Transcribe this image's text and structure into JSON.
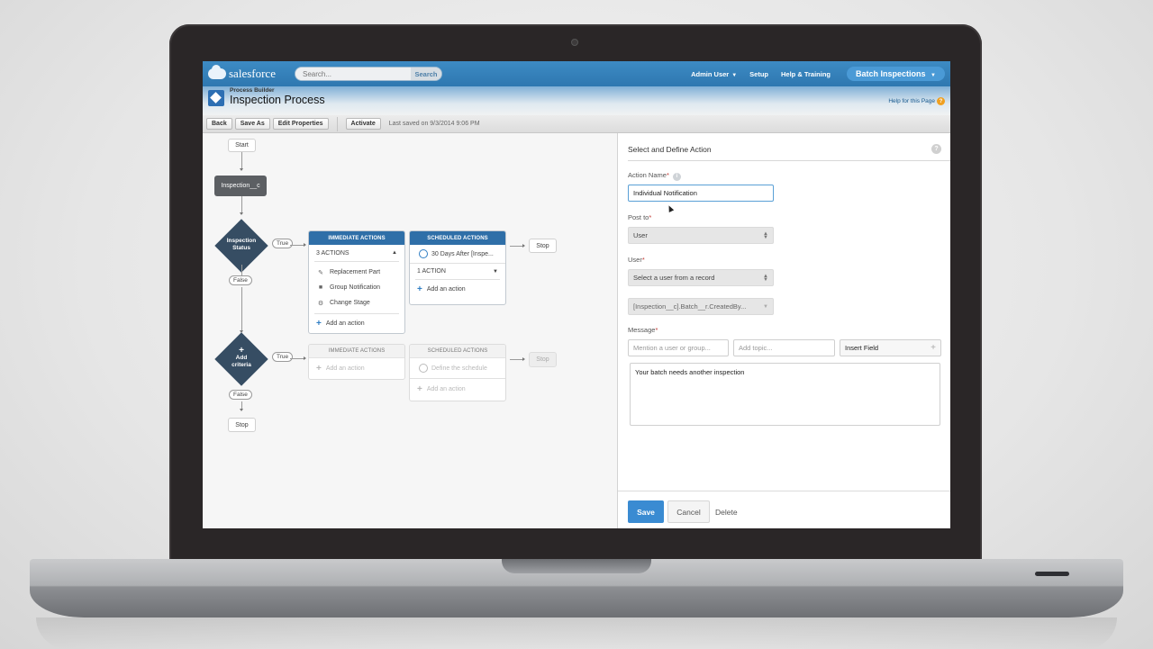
{
  "topbar": {
    "logo_text": "salesforce",
    "search_placeholder": "Search...",
    "search_button": "Search",
    "user_menu": "Admin User",
    "setup": "Setup",
    "help_training": "Help & Training",
    "app_picker": "Batch Inspections"
  },
  "header": {
    "subtitle": "Process Builder",
    "title": "Inspection Process",
    "help_link": "Help for this Page"
  },
  "toolbar": {
    "back": "Back",
    "save_as": "Save As",
    "edit_properties": "Edit Properties",
    "activate": "Activate",
    "last_saved": "Last saved on 9/3/2014 9:06 PM"
  },
  "canvas": {
    "start": "Start",
    "object": "Inspection__c",
    "criteria1": {
      "line1": "Inspection",
      "line2": "Status"
    },
    "criteria2": {
      "line1": "Add",
      "line2": "criteria"
    },
    "true_label": "True",
    "false_label": "False",
    "stop_label": "Stop",
    "immediate_actions": {
      "header": "IMMEDIATE ACTIONS",
      "count": "3 ACTIONS",
      "items": [
        {
          "icon": "pencil-icon",
          "label": "Replacement Part"
        },
        {
          "icon": "chat-icon",
          "label": "Group Notification"
        },
        {
          "icon": "gear-icon",
          "label": "Change Stage"
        }
      ],
      "add": "Add an action"
    },
    "scheduled_actions": {
      "header": "SCHEDULED ACTIONS",
      "schedule": "30 Days After [Inspe...",
      "count": "1 ACTION",
      "add": "Add an action"
    },
    "ghost_immediate": {
      "header": "IMMEDIATE ACTIONS",
      "add": "Add an action"
    },
    "ghost_scheduled": {
      "header": "SCHEDULED ACTIONS",
      "schedule": "Define the schedule",
      "add": "Add an action"
    }
  },
  "panel": {
    "title": "Select and Define Action",
    "action_name_label": "Action Name",
    "action_name_value": "Individual Notification",
    "post_to_label": "Post to",
    "post_to_value": "User",
    "user_label": "User",
    "user_value": "Select a user from a record",
    "user_field_value": "[Inspection__c].Batch__r.CreatedBy...",
    "message_label": "Message",
    "mention_placeholder": "Mention a user or group...",
    "topic_placeholder": "Add topic...",
    "insert_field": "Insert Field",
    "message_value": "Your batch needs another inspection",
    "save": "Save",
    "cancel": "Cancel",
    "delete": "Delete"
  }
}
